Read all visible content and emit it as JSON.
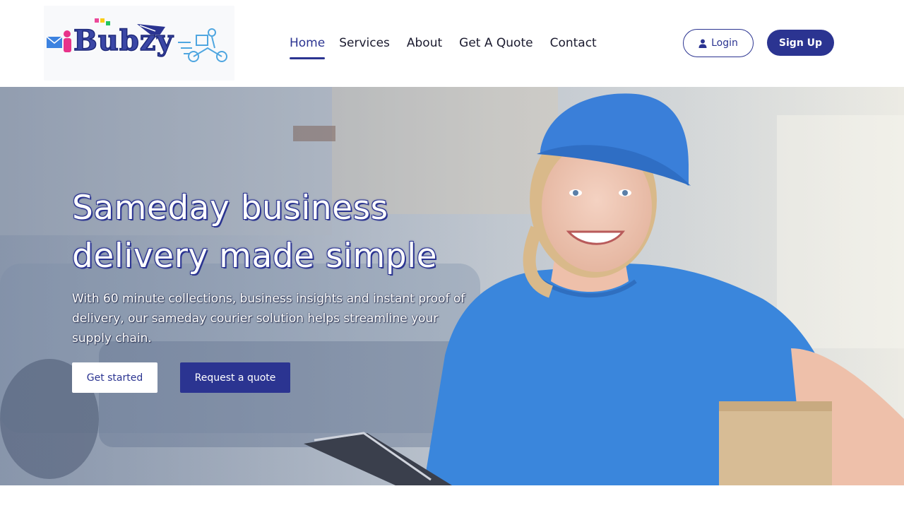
{
  "brand": {
    "name": "Bubzy",
    "primary": "#2b3491",
    "accent_blue": "#3c82e0"
  },
  "nav": {
    "items": [
      {
        "label": "Home",
        "active": true
      },
      {
        "label": "Services",
        "active": false
      },
      {
        "label": "About",
        "active": false
      },
      {
        "label": "Get A Quote",
        "active": false
      },
      {
        "label": "Contact",
        "active": false
      }
    ]
  },
  "auth": {
    "login_label": "Login",
    "login_icon": "user-icon",
    "signup_label": "Sign Up"
  },
  "hero": {
    "title_line1": "Sameday business",
    "title_line2": "delivery made simple",
    "subtitle": "With 60 minute collections, business insights and instant proof of delivery, our sameday courier solution helps streamline your supply chain.",
    "primary_cta": "Get started",
    "secondary_cta": "Request a quote"
  }
}
